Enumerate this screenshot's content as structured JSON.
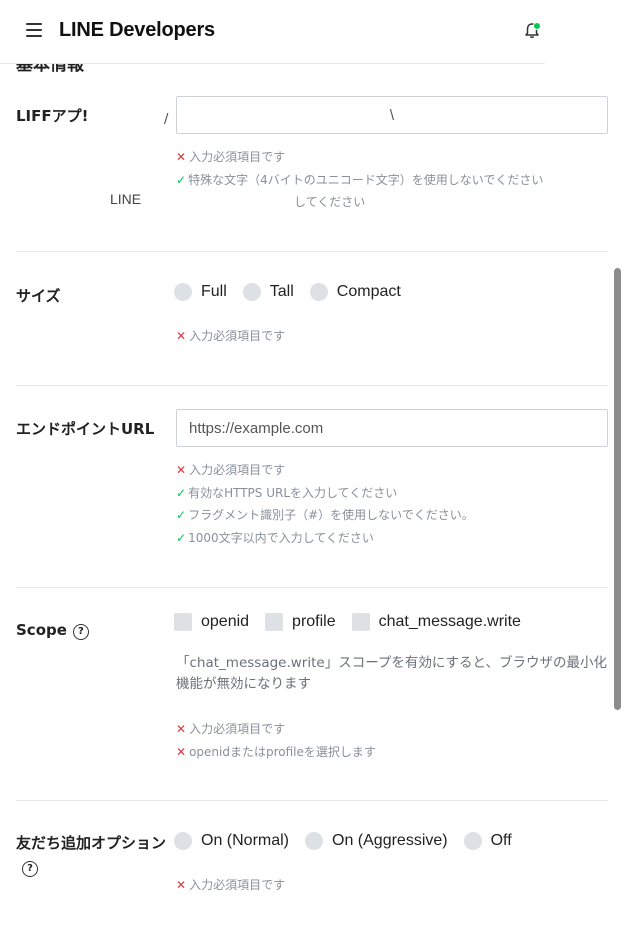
{
  "header": {
    "brand": "LINE Developers"
  },
  "section_title_partial": "基本情報",
  "app_name": {
    "label": "LIFFアプ!",
    "slash": "/",
    "line_text": "LINE",
    "input_value": "\\",
    "validations": [
      {
        "status": "error",
        "text": "入力必須項目です"
      },
      {
        "status": "ok",
        "text": "特殊な文字（4バイトのユニコード文字）を使用しないでください"
      },
      {
        "status": "none",
        "text": "してください"
      }
    ]
  },
  "size": {
    "label": "サイズ",
    "options": [
      "Full",
      "Tall",
      "Compact"
    ],
    "validations": [
      {
        "status": "error",
        "text": "入力必須項目です"
      }
    ]
  },
  "endpoint": {
    "label": "エンドポイントURL",
    "placeholder": "https://example.com",
    "validations": [
      {
        "status": "error",
        "text": "入力必須項目です"
      },
      {
        "status": "ok",
        "text": "有効なHTTPS URLを入力してください"
      },
      {
        "status": "ok",
        "text": "フラグメント識別子（#）を使用しないでください。"
      },
      {
        "status": "ok",
        "text": "1000文字以内で入力してください"
      }
    ]
  },
  "scope": {
    "label": "Scope",
    "help": "?",
    "options": [
      "openid",
      "profile",
      "chat_message.write"
    ],
    "note": "「chat_message.write」スコープを有効にすると、ブラウザの最小化機能が無効になります",
    "validations": [
      {
        "status": "error",
        "text": "入力必須項目です"
      },
      {
        "status": "error",
        "text": "openidまたはprofileを選択します"
      }
    ]
  },
  "friend_option": {
    "label": "友だち追加オプション",
    "help": "?",
    "options": [
      "On (Normal)",
      "On (Aggressive)",
      "Off"
    ],
    "validations": [
      {
        "status": "error",
        "text": "入力必須項目です"
      }
    ]
  },
  "icons": {
    "menu": "hamburger-menu-icon",
    "bell": "notification-bell-icon",
    "help": "help-circle-icon",
    "error": "cross-icon",
    "ok": "check-icon"
  },
  "colors": {
    "error": "#e5333f",
    "ok": "#06c755",
    "control": "#dde1e6",
    "validation_text": "#8a9099"
  }
}
